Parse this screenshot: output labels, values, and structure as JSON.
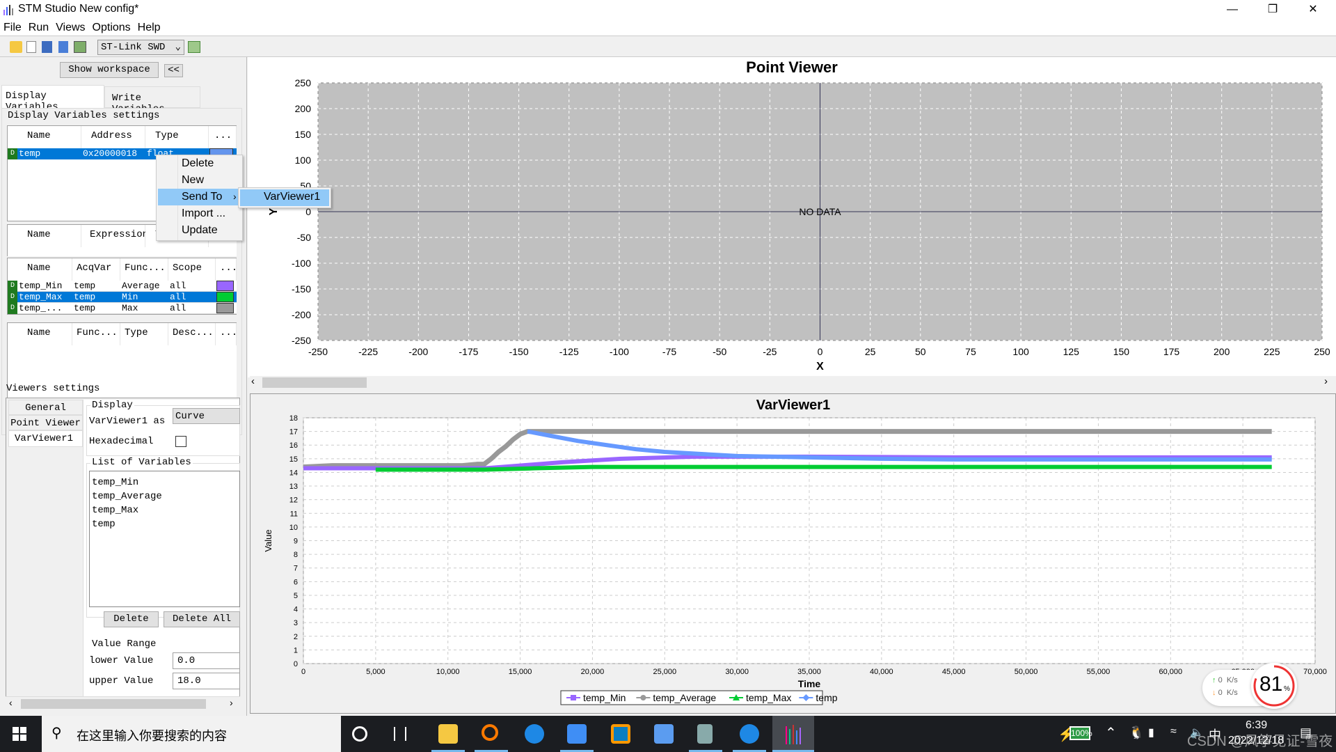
{
  "window": {
    "title": "STM Studio New config*",
    "app_icon": "bar-chart-icon",
    "controls": [
      "minimize-icon",
      "restore-icon",
      "close-icon"
    ]
  },
  "menu": [
    "File",
    "Run",
    "Views",
    "Options",
    "Help"
  ],
  "toolbar": {
    "connection": "ST-Link SWD",
    "icons": [
      "open-folder-icon",
      "new-file-icon",
      "save-as-icon",
      "save-icon",
      "export-icon",
      "table-icon"
    ]
  },
  "left": {
    "show_workspace": "Show workspace",
    "collapse": "<<",
    "tabs": [
      "Display Variables",
      "Write Variables"
    ],
    "group_title": "Display Variables settings",
    "vars_table": {
      "headers": [
        "Name",
        "Address",
        "Type",
        "..."
      ],
      "rows": [
        {
          "badge": "D",
          "name": "temp",
          "address": "0x20000018",
          "type": "float",
          "color": "#6495ed"
        }
      ]
    },
    "expr_table": {
      "headers": [
        "Name",
        "Expression",
        "Ty"
      ]
    },
    "acq_table": {
      "headers": [
        "Name",
        "AcqVar",
        "Func...",
        "Scope",
        "..."
      ],
      "rows": [
        {
          "badge": "D",
          "name": "temp_Min",
          "acq": "temp",
          "func": "Average",
          "scope": "all",
          "color": "#9966ff"
        },
        {
          "badge": "D",
          "name": "temp_Max",
          "acq": "temp",
          "func": "Min",
          "scope": "all",
          "color": "#00cc33"
        },
        {
          "badge": "D",
          "name": "temp_...",
          "acq": "temp",
          "func": "Max",
          "scope": "all",
          "color": "#999999"
        }
      ]
    },
    "func_table": {
      "headers": [
        "Name",
        "Func...",
        "Type",
        "Desc...",
        "..."
      ]
    },
    "context_menu": {
      "items": [
        "Delete",
        "New",
        "Send To",
        "Import ...",
        "Update"
      ],
      "submenu": [
        "VarViewer1"
      ]
    },
    "viewers": {
      "title": "Viewers settings",
      "tabs": [
        "General",
        "Point Viewer",
        "VarViewer1"
      ],
      "display_label": "Display",
      "as_label": "VarViewer1 as",
      "as_value": "Curve",
      "hex_label": "Hexadecimal",
      "hex_checked": false,
      "list_label": "List of Variables",
      "list": [
        "temp_Min",
        "temp_Average",
        "temp_Max",
        "temp"
      ],
      "delete": "Delete",
      "delete_all": "Delete All",
      "range_label": "Value Range",
      "lower_label": "lower Value",
      "lower": "0.0",
      "upper_label": "upper Value",
      "upper": "18.0"
    }
  },
  "chart_data": [
    {
      "type": "scatter",
      "title": "Point Viewer",
      "xlabel": "X",
      "ylabel": "Y",
      "xlim": [
        -250,
        250
      ],
      "ylim": [
        -250,
        250
      ],
      "xticks": [
        -250,
        -225,
        -200,
        -175,
        -150,
        -125,
        -100,
        -75,
        -50,
        -25,
        0,
        25,
        50,
        75,
        100,
        125,
        150,
        175,
        200,
        225,
        250
      ],
      "yticks": [
        250,
        200,
        150,
        100,
        50,
        0,
        -50,
        -100,
        -150,
        -200,
        -250
      ],
      "grid": true,
      "message": "NO DATA",
      "background": "#c0c0c0"
    },
    {
      "type": "line",
      "title": "VarViewer1",
      "xlabel": "Time",
      "ylabel": "Value",
      "xlim": [
        0,
        70000
      ],
      "ylim": [
        0,
        18
      ],
      "xticks": [
        "0",
        "5,000",
        "10,000",
        "15,000",
        "20,000",
        "25,000",
        "30,000",
        "35,000",
        "40,000",
        "45,000",
        "50,000",
        "55,000",
        "60,000",
        "65,000",
        "70,000"
      ],
      "yticks": [
        0,
        1,
        2,
        3,
        4,
        5,
        6,
        7,
        8,
        9,
        10,
        11,
        12,
        13,
        14,
        15,
        16,
        17,
        18
      ],
      "grid": true,
      "legend": "bottom",
      "series": [
        {
          "name": "temp_Min",
          "color": "#9966ff",
          "marker": "square",
          "points": [
            [
              0,
              14.3
            ],
            [
              12500,
              14.3
            ],
            [
              15000,
              14.5
            ],
            [
              18000,
              14.75
            ],
            [
              22000,
              15.0
            ],
            [
              27000,
              15.15
            ],
            [
              35000,
              15.15
            ],
            [
              45000,
              15.1
            ],
            [
              67000,
              15.1
            ]
          ]
        },
        {
          "name": "temp_Average",
          "color": "#999999",
          "marker": "circle",
          "points": [
            [
              0,
              14.4
            ],
            [
              2000,
              14.5
            ],
            [
              11000,
              14.5
            ],
            [
              12000,
              14.6
            ],
            [
              12500,
              14.6
            ],
            [
              13000,
              15.0
            ],
            [
              13500,
              15.5
            ],
            [
              14000,
              15.9
            ],
            [
              14500,
              16.4
            ],
            [
              15000,
              16.8
            ],
            [
              15500,
              17.0
            ],
            [
              67000,
              17.0
            ]
          ]
        },
        {
          "name": "temp_Max",
          "color": "#00cc33",
          "marker": "triangle",
          "points": [
            [
              5000,
              14.2
            ],
            [
              12500,
              14.2
            ],
            [
              16000,
              14.3
            ],
            [
              20000,
              14.4
            ],
            [
              67000,
              14.4
            ]
          ]
        },
        {
          "name": "temp",
          "color": "#6699ff",
          "marker": "diamond",
          "points": [
            [
              15500,
              17.0
            ],
            [
              17000,
              16.7
            ],
            [
              19000,
              16.3
            ],
            [
              21000,
              16.0
            ],
            [
              23000,
              15.7
            ],
            [
              25000,
              15.5
            ],
            [
              30000,
              15.2
            ],
            [
              40000,
              15.0
            ],
            [
              45000,
              14.95
            ],
            [
              67000,
              14.95
            ]
          ]
        }
      ]
    }
  ],
  "tray": {
    "upload": "0",
    "download": "0",
    "unit": "K/s",
    "cpu_percent": "81",
    "percent_sign": "%",
    "battery": "100%",
    "ime": "中",
    "time": "6:39",
    "date": "2022/12/18",
    "watermark": "CSDN @风筝见证-雪夜"
  },
  "taskbar": {
    "search_placeholder": "在这里输入你要搜索的内容",
    "apps": [
      "cortana-icon",
      "task-view-icon",
      "file-explorer-icon",
      "search-app-icon",
      "edge-icon",
      "cloud-app-icon",
      "remote-icon",
      "cloud-pro-icon",
      "calculator-icon",
      "edge-icon-2",
      "stm-studio-icon"
    ]
  }
}
